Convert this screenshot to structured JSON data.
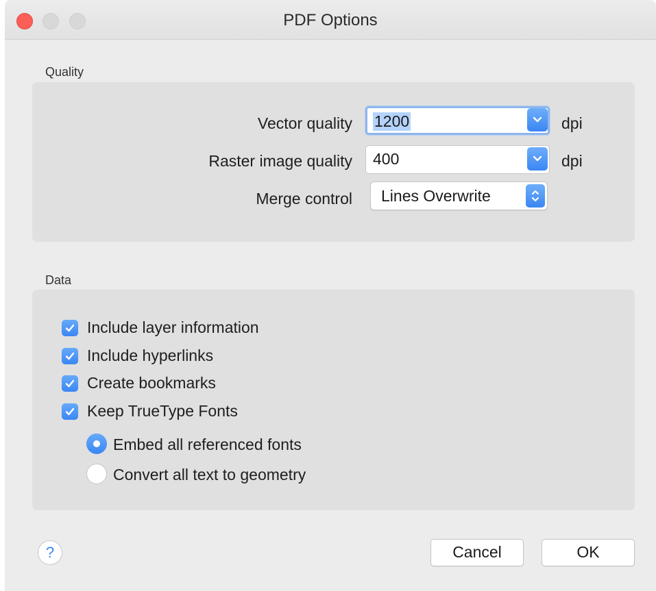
{
  "window": {
    "title": "PDF Options"
  },
  "quality": {
    "section_label": "Quality",
    "vector_label": "Vector quality",
    "vector_value": "1200",
    "vector_unit": "dpi",
    "raster_label": "Raster image quality",
    "raster_value": "400",
    "raster_unit": "dpi",
    "merge_label": "Merge control",
    "merge_value": "Lines Overwrite"
  },
  "data": {
    "section_label": "Data",
    "checkboxes": [
      {
        "label": "Include layer information",
        "checked": true
      },
      {
        "label": "Include hyperlinks",
        "checked": true
      },
      {
        "label": "Create bookmarks",
        "checked": true
      },
      {
        "label": "Keep TrueType Fonts",
        "checked": true
      }
    ],
    "radios": [
      {
        "label": "Embed all referenced fonts",
        "selected": true
      },
      {
        "label": "Convert all text to geometry",
        "selected": false
      }
    ]
  },
  "footer": {
    "help_label": "?",
    "cancel_label": "Cancel",
    "ok_label": "OK"
  },
  "colors": {
    "accent": "#3a86f3",
    "close_button": "#fc5f57"
  }
}
